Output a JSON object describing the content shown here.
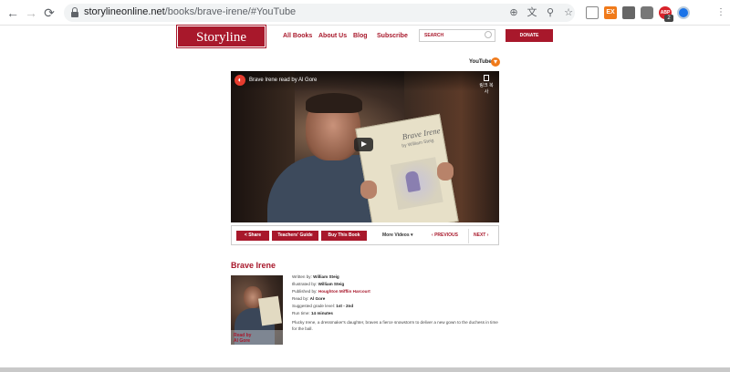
{
  "browser": {
    "url_host": "storylineonline.net",
    "url_path": "/books/brave-irene/#YouTube",
    "extensions": [
      {
        "name": "ex-extension-icon",
        "label": "EX",
        "color": "#f07a1a"
      },
      {
        "name": "extension-icon-1",
        "label": "",
        "color": "#666666"
      },
      {
        "name": "extension-icon-2",
        "label": "",
        "color": "#777777"
      },
      {
        "name": "adblock-extension-icon",
        "label": "ABP",
        "color": "#d8232a",
        "badge": "2"
      },
      {
        "name": "profile-extension-icon",
        "label": "",
        "color": "#1a73e8"
      }
    ]
  },
  "site": {
    "logo": "Storyline Online",
    "nav": [
      "All Books",
      "About Us",
      "Blog",
      "Subscribe"
    ],
    "search_placeholder": "SEARCH",
    "donate": "DONATE",
    "accent": "#a8182b"
  },
  "video": {
    "toggle_label": "YouTube",
    "title": "Brave Irene read by Al Gore",
    "copy_label": "링크 복사",
    "book_cover_title": "Brave Irene",
    "book_cover_author": "by William Steig"
  },
  "controls": {
    "share": "Share",
    "teachers_guide": "Teachers' Guide",
    "buy": "Buy This Book",
    "more_videos": "More Videos",
    "previous": "PREVIOUS",
    "next": "NEXT"
  },
  "book": {
    "title": "Brave Irene",
    "thumb_caption_1": "Read by",
    "thumb_caption_2": "Al Gore",
    "written_label": "Written by:",
    "written": "William Steig",
    "illustrated_label": "Illustrated by:",
    "illustrated": "William Steig",
    "published_label": "Published by:",
    "published": "Houghton Mifflin Harcourt",
    "read_label": "Read by:",
    "read": "Al Gore",
    "grade_label": "Suggested grade level:",
    "grade": "1st - 2nd",
    "runtime_label": "Run time:",
    "runtime": "14 minutes",
    "description": "Plucky Irene, a dressmaker's daughter, braves a fierce snowstorm to deliver a new gown to the duchess in time for the ball."
  }
}
